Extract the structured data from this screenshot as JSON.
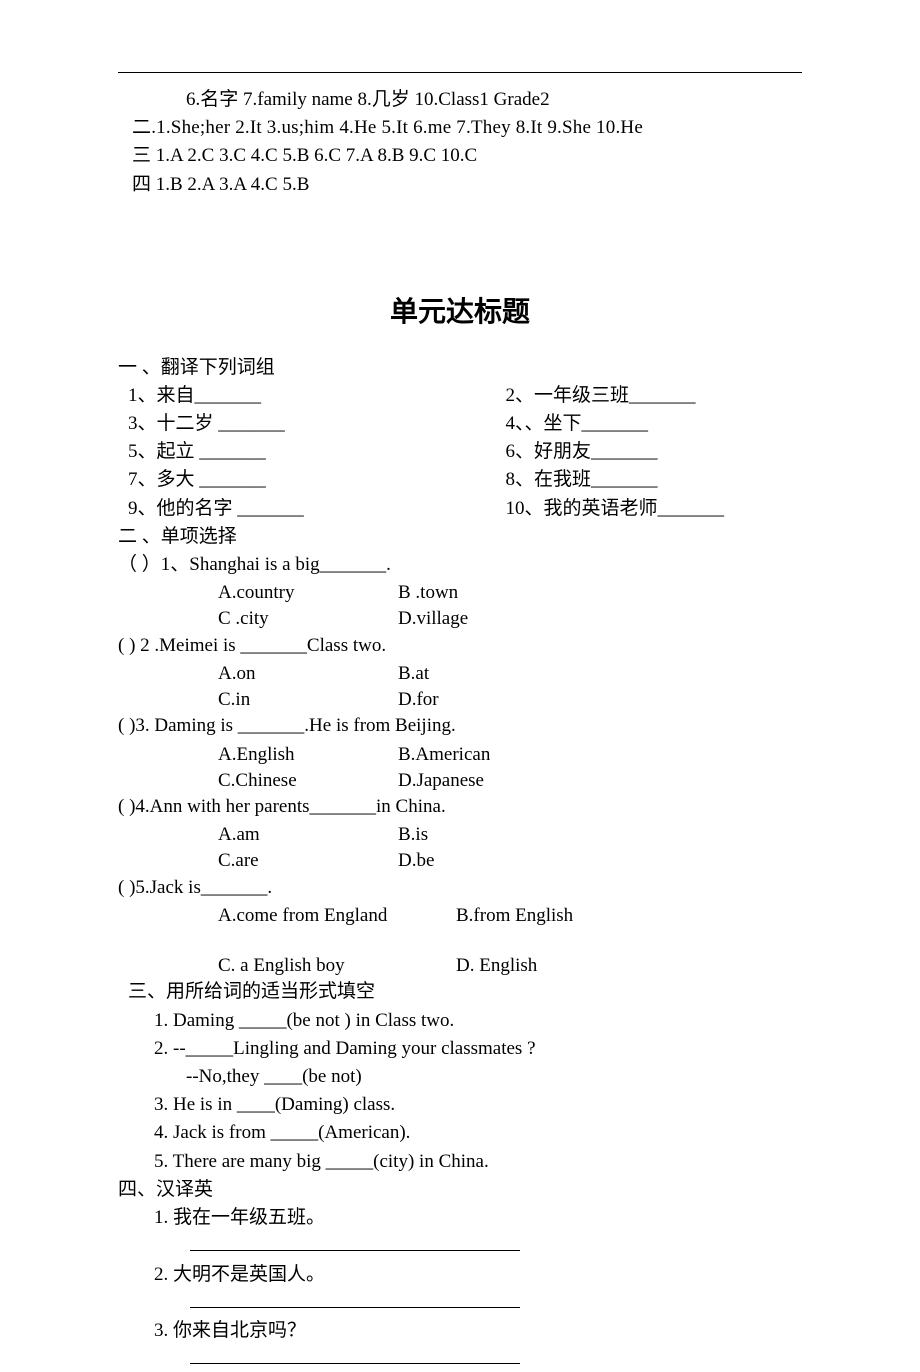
{
  "ans_block": {
    "line1": "6.名字      7.family name      8.几岁                    10.Class1 Grade2",
    "line2": "二.1.She;her    2.It   3.us;him   4.He     5.It     6.me      7.They      8.It     9.She    10.He",
    "line3": "三  1.A   2.C   3.C   4.C   5.B   6.C   7.A   8.B   9.C   10.C",
    "line4": "四  1.B   2.A     3.A   4.C   5.B"
  },
  "title": "单元达标题",
  "s1": {
    "h": "一 、翻译下列词组",
    "left": [
      "1、来自_______",
      "3、十二岁 _______",
      "5、起立  _______",
      "7、多大   _______",
      "9、他的名字 _______"
    ],
    "right": [
      "2、一年级三班_______",
      "4、、坐下_______",
      "6、好朋友_______",
      "8、在我班_______",
      "10、我的英语老师_______"
    ]
  },
  "s2": {
    "h": "二 、单项选择",
    "q1": {
      "stem": "（      ）1、Shanghai is a big_______.",
      "A": "A.country",
      "B": "B .town",
      "C": "C .city",
      "D": "D.village"
    },
    "q2": {
      "stem": "(       ) 2 .Meimei is _______Class two.",
      "A": "A.on",
      "B": "B.at",
      "C": "C.in",
      "D": "D.for"
    },
    "q3": {
      "stem": "(       )3. Daming is _______.He is from Beijing.",
      "A": "A.English",
      "B": "B.American",
      "C": "C.Chinese",
      "D": "D.Japanese"
    },
    "q4": {
      "stem": "(       )4.Ann with her parents_______in China.",
      "A": "A.am",
      "B": "B.is",
      "C": "C.are",
      "D": "D.be"
    },
    "q5": {
      "stem": "(       )5.Jack is_______.",
      "A": "A.come from England",
      "B": "B.from English",
      "C": "C. a English boy",
      "D": "D. English"
    }
  },
  "s3": {
    "h": "三、用所给词的适当形式填空",
    "q1": "1.  Daming _____(be not ) in Class two.",
    "q2": "2.  --_____Lingling and Daming your classmates ?",
    "q2b": "--No,they ____(be    not)",
    "q3": "3.  He is in ____(Daming) class.",
    "q4": "4.  Jack is from _____(American).",
    "q5": "5.  There are many big _____(city) in China."
  },
  "s4": {
    "h": "四、汉译英",
    "q1": "1.  我在一年级五班。",
    "q2": "2.  大明不是英国人。",
    "q3": "3.  你来自北京吗？"
  }
}
